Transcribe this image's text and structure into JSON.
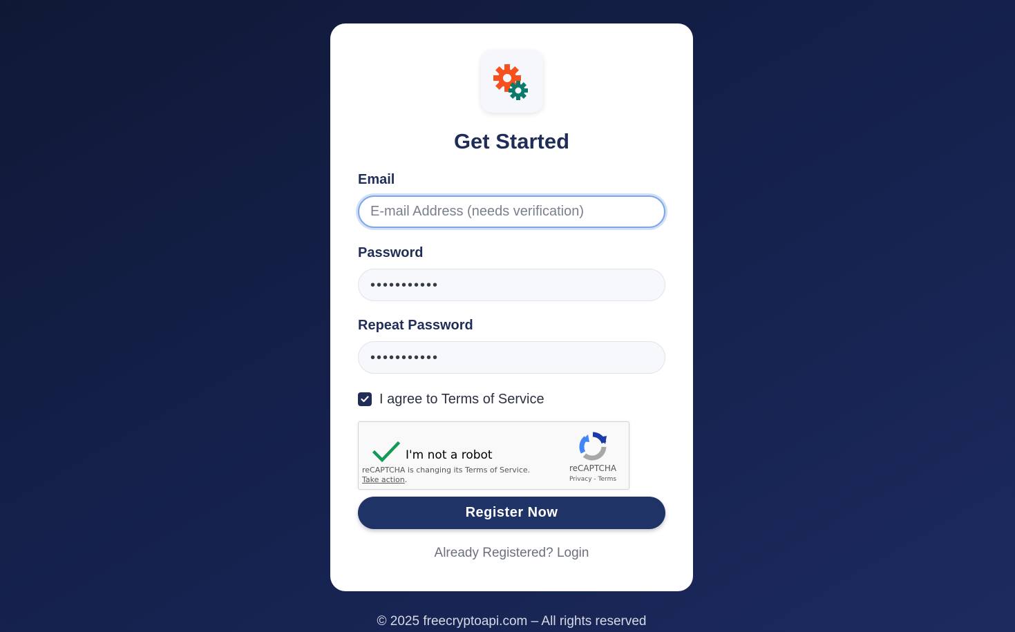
{
  "card": {
    "title": "Get Started"
  },
  "form": {
    "email": {
      "label": "Email",
      "placeholder": "E-mail Address (needs verification)",
      "value": ""
    },
    "password": {
      "label": "Password",
      "masked_value": "•••••••••••"
    },
    "repeat_password": {
      "label": "Repeat Password",
      "masked_value": "•••••••••••"
    },
    "agree": {
      "checked": true,
      "label": "I agree to Terms of Service"
    },
    "recaptcha": {
      "label": "I'm not a robot",
      "notice": "reCAPTCHA is changing its Terms of Service.",
      "notice_link": "Take action",
      "brand": "reCAPTCHA",
      "privacy": "Privacy",
      "terms": "Terms",
      "checked": true
    },
    "submit_label": "Register Now",
    "login_link": "Already Registered? Login"
  },
  "footer": {
    "text": "© 2025 freecryptoapi.com – All rights reserved"
  },
  "colors": {
    "primary": "#1f3366",
    "accent_orange": "#f4511e",
    "accent_teal": "#0b7a6b",
    "focus_ring": "#7da6e9",
    "check_green": "#159957"
  },
  "icons": {
    "logo": "gears-icon",
    "agree_check": "check-icon",
    "recaptcha_check": "green-check-icon",
    "recaptcha_logo": "recaptcha-logo-icon"
  }
}
